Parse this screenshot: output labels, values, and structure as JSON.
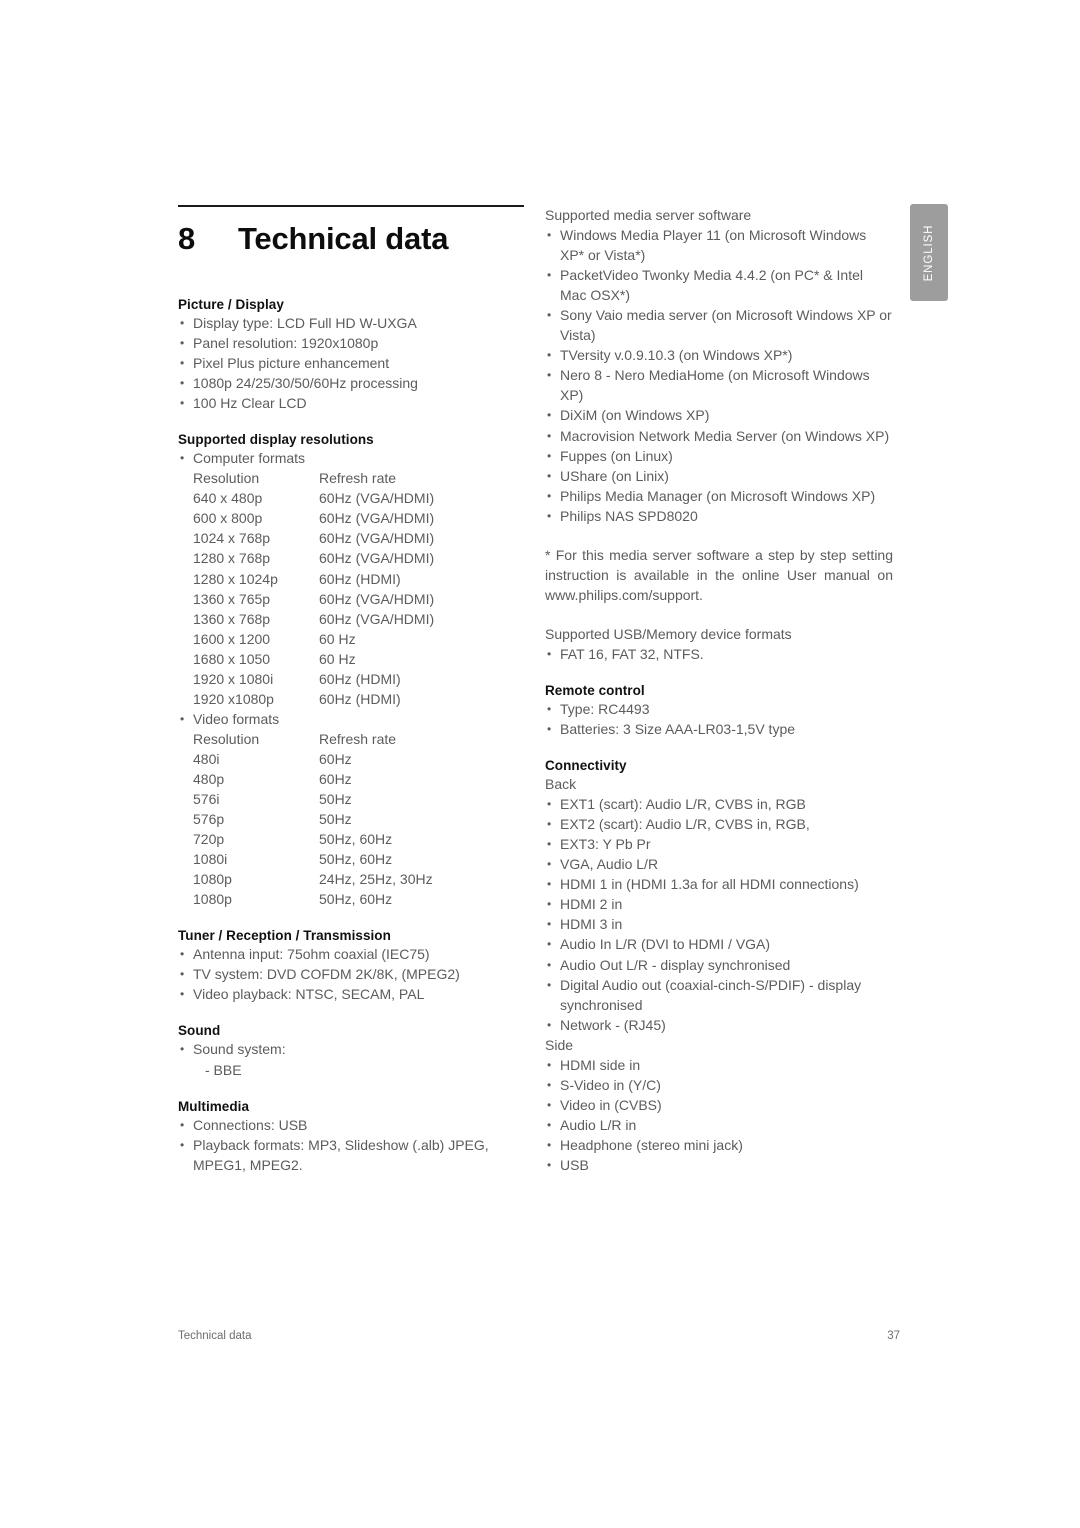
{
  "language_tab": "ENGLISH",
  "chapter": {
    "number": "8",
    "title": "Technical data"
  },
  "footer": {
    "left": "Technical data",
    "page": "37"
  },
  "left_column": {
    "picture_display": {
      "heading": "Picture / Display",
      "items": [
        "Display type: LCD Full HD W-UXGA",
        "Panel resolution: 1920x1080p",
        "Pixel Plus picture enhancement",
        "1080p 24/25/30/50/60Hz processing",
        "100 Hz Clear LCD"
      ]
    },
    "display_resolutions": {
      "heading": "Supported display resolutions",
      "computer_formats_label": "Computer formats",
      "computer_table": {
        "headers": [
          "Resolution",
          "Refresh rate"
        ],
        "rows": [
          [
            "640 x 480p",
            "60Hz (VGA/HDMI)"
          ],
          [
            "600 x 800p",
            "60Hz (VGA/HDMI)"
          ],
          [
            "1024 x 768p",
            "60Hz (VGA/HDMI)"
          ],
          [
            "1280 x 768p",
            "60Hz (VGA/HDMI)"
          ],
          [
            "1280 x 1024p",
            "60Hz (HDMI)"
          ],
          [
            "1360 x 765p",
            "60Hz (VGA/HDMI)"
          ],
          [
            "1360 x 768p",
            "60Hz (VGA/HDMI)"
          ],
          [
            "1600 x 1200",
            "60 Hz"
          ],
          [
            "1680 x 1050",
            "60 Hz"
          ],
          [
            "1920 x 1080i",
            "60Hz (HDMI)"
          ],
          [
            "1920 x1080p",
            "60Hz (HDMI)"
          ]
        ]
      },
      "video_formats_label": "Video formats",
      "video_table": {
        "headers": [
          "Resolution",
          "Refresh rate"
        ],
        "rows": [
          [
            "480i",
            "60Hz"
          ],
          [
            "480p",
            "60Hz"
          ],
          [
            "576i",
            "50Hz"
          ],
          [
            "576p",
            "50Hz"
          ],
          [
            "720p",
            "50Hz, 60Hz"
          ],
          [
            "1080i",
            "50Hz, 60Hz"
          ],
          [
            "1080p",
            "24Hz, 25Hz, 30Hz"
          ],
          [
            "1080p",
            "50Hz, 60Hz"
          ]
        ]
      }
    },
    "tuner": {
      "heading": "Tuner / Reception / Transmission",
      "items": [
        "Antenna input: 75ohm coaxial (IEC75)",
        "TV system: DVD COFDM 2K/8K, (MPEG2)",
        "Video playback: NTSC, SECAM, PAL"
      ]
    },
    "sound": {
      "heading": "Sound",
      "items": [
        "Sound system:"
      ],
      "sub_items": [
        "- BBE"
      ]
    },
    "multimedia": {
      "heading": "Multimedia",
      "items": [
        "Connections: USB",
        "Playback formats: MP3, Slideshow (.alb) JPEG, MPEG1, MPEG2."
      ]
    }
  },
  "right_column": {
    "media_server": {
      "heading": "Supported media server software",
      "items": [
        "Windows Media Player 11 (on Microsoft Windows XP* or Vista*)",
        "PacketVideo Twonky Media 4.4.2 (on PC* & Intel Mac OSX*)",
        "Sony Vaio media server (on Microsoft Windows XP or Vista)",
        "TVersity v.0.9.10.3 (on Windows XP*)",
        "Nero 8 - Nero MediaHome (on Microsoft Windows XP)",
        "DiXiM (on Windows XP)",
        "Macrovision Network Media Server (on Windows XP)",
        "Fuppes (on Linux)",
        "UShare (on Linix)",
        "Philips Media Manager (on Microsoft Windows XP)",
        "Philips NAS SPD8020"
      ]
    },
    "footnote": "* For this media server software a step by step setting instruction is available in the online User manual on www.philips.com/support.",
    "usb_formats": {
      "heading": "Supported USB/Memory device formats",
      "items": [
        "FAT 16, FAT 32, NTFS."
      ]
    },
    "remote_control": {
      "heading": "Remote control",
      "items": [
        "Type: RC4493",
        "Batteries: 3 Size AAA-LR03-1,5V type"
      ]
    },
    "connectivity": {
      "heading": "Connectivity",
      "back_label": "Back",
      "back_items": [
        "EXT1 (scart): Audio L/R, CVBS in, RGB",
        "EXT2 (scart): Audio L/R, CVBS in, RGB,",
        "EXT3: Y Pb Pr",
        "VGA, Audio L/R",
        "HDMI 1 in (HDMI 1.3a for all HDMI connections)",
        "HDMI 2 in",
        "HDMI 3 in",
        "Audio In L/R (DVI to HDMI / VGA)",
        "Audio Out L/R - display synchronised",
        "Digital Audio out (coaxial-cinch-S/PDIF) - display synchronised",
        "Network - (RJ45)"
      ],
      "side_label": "Side",
      "side_items": [
        "HDMI side in",
        "S-Video in (Y/C)",
        "Video in (CVBS)",
        "Audio L/R in",
        "Headphone (stereo mini jack)",
        "USB"
      ]
    }
  }
}
